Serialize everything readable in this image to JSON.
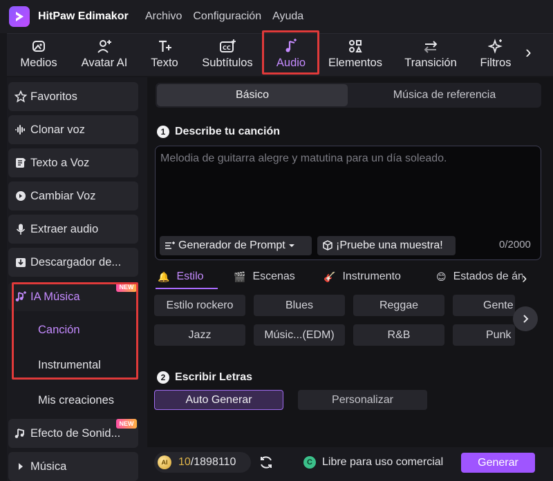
{
  "app": {
    "name": "HitPaw Edimakor",
    "menu": [
      "Archivo",
      "Configuración",
      "Ayuda"
    ]
  },
  "toolbar": {
    "items": [
      {
        "label": "Medios",
        "icon": "media-icon"
      },
      {
        "label": "Avatar AI",
        "icon": "avatar-icon"
      },
      {
        "label": "Texto",
        "icon": "text-icon"
      },
      {
        "label": "Subtítulos",
        "icon": "subtitles-icon"
      },
      {
        "label": "Audio",
        "icon": "music-note-icon",
        "active": true
      },
      {
        "label": "Elementos",
        "icon": "elements-icon"
      },
      {
        "label": "Transición",
        "icon": "transition-icon"
      },
      {
        "label": "Filtros",
        "icon": "sparkle-icon"
      }
    ],
    "more_icon": "chevron-right-icon"
  },
  "sidebar": {
    "items": [
      {
        "label": "Favoritos",
        "icon": "star-icon"
      },
      {
        "label": "Clonar voz",
        "icon": "waveform-icon"
      },
      {
        "label": "Texto a Voz",
        "icon": "text-to-speech-icon"
      },
      {
        "label": "Cambiar Voz",
        "icon": "voice-change-icon"
      },
      {
        "label": "Extraer audio",
        "icon": "microphone-icon"
      },
      {
        "label": "Descargador de...",
        "icon": "download-icon"
      },
      {
        "label": "IA Música",
        "icon": "ai-music-icon",
        "badge": "NEW",
        "active": true
      }
    ],
    "sub_items": [
      "Canción",
      "Instrumental",
      "Mis creaciones"
    ],
    "items_after": [
      {
        "label": "Efecto de Sonid...",
        "icon": "sound-effect-icon",
        "badge": "NEW"
      },
      {
        "label": "Música",
        "icon": "caret-right-icon"
      }
    ]
  },
  "main": {
    "segments": [
      "Básico",
      "Música de referencia"
    ],
    "step1": {
      "num": "1",
      "title": "Describe tu canción"
    },
    "prompt": {
      "placeholder": "Melodia de guitarra alegre y matutina para un día soleado.",
      "generator_label": "Generador de Prompt",
      "sample_label": "¡Pruebe una muestra!",
      "counter": "0/2000"
    },
    "tabs": [
      {
        "label": "Estilo",
        "icon": "bell-icon",
        "active": true
      },
      {
        "label": "Escenas",
        "icon": "clapper-icon"
      },
      {
        "label": "Instrumento",
        "icon": "guitar-icon"
      },
      {
        "label": "Estados de án",
        "icon": "emoji-icon"
      }
    ],
    "chips_row1": [
      "Estilo rockero",
      "Blues",
      "Reggae",
      "Gente"
    ],
    "chips_row2": [
      "Jazz",
      "Músic...(EDM)",
      "R&B",
      "Punk"
    ],
    "step2": {
      "num": "2",
      "title": "Escribir Letras"
    },
    "lyrics_modes": [
      "Auto Generar",
      "Personalizar"
    ]
  },
  "footer": {
    "coin_label": "AI",
    "credits_used": "10",
    "credits_total": "/1898110",
    "free_label": "Libre para uso comercial",
    "free_icon_text": "C",
    "generate_label": "Generar"
  },
  "colors": {
    "accent": "#a96bff",
    "highlight_box": "#e03a3a",
    "generate_button": "#9f55ff"
  }
}
